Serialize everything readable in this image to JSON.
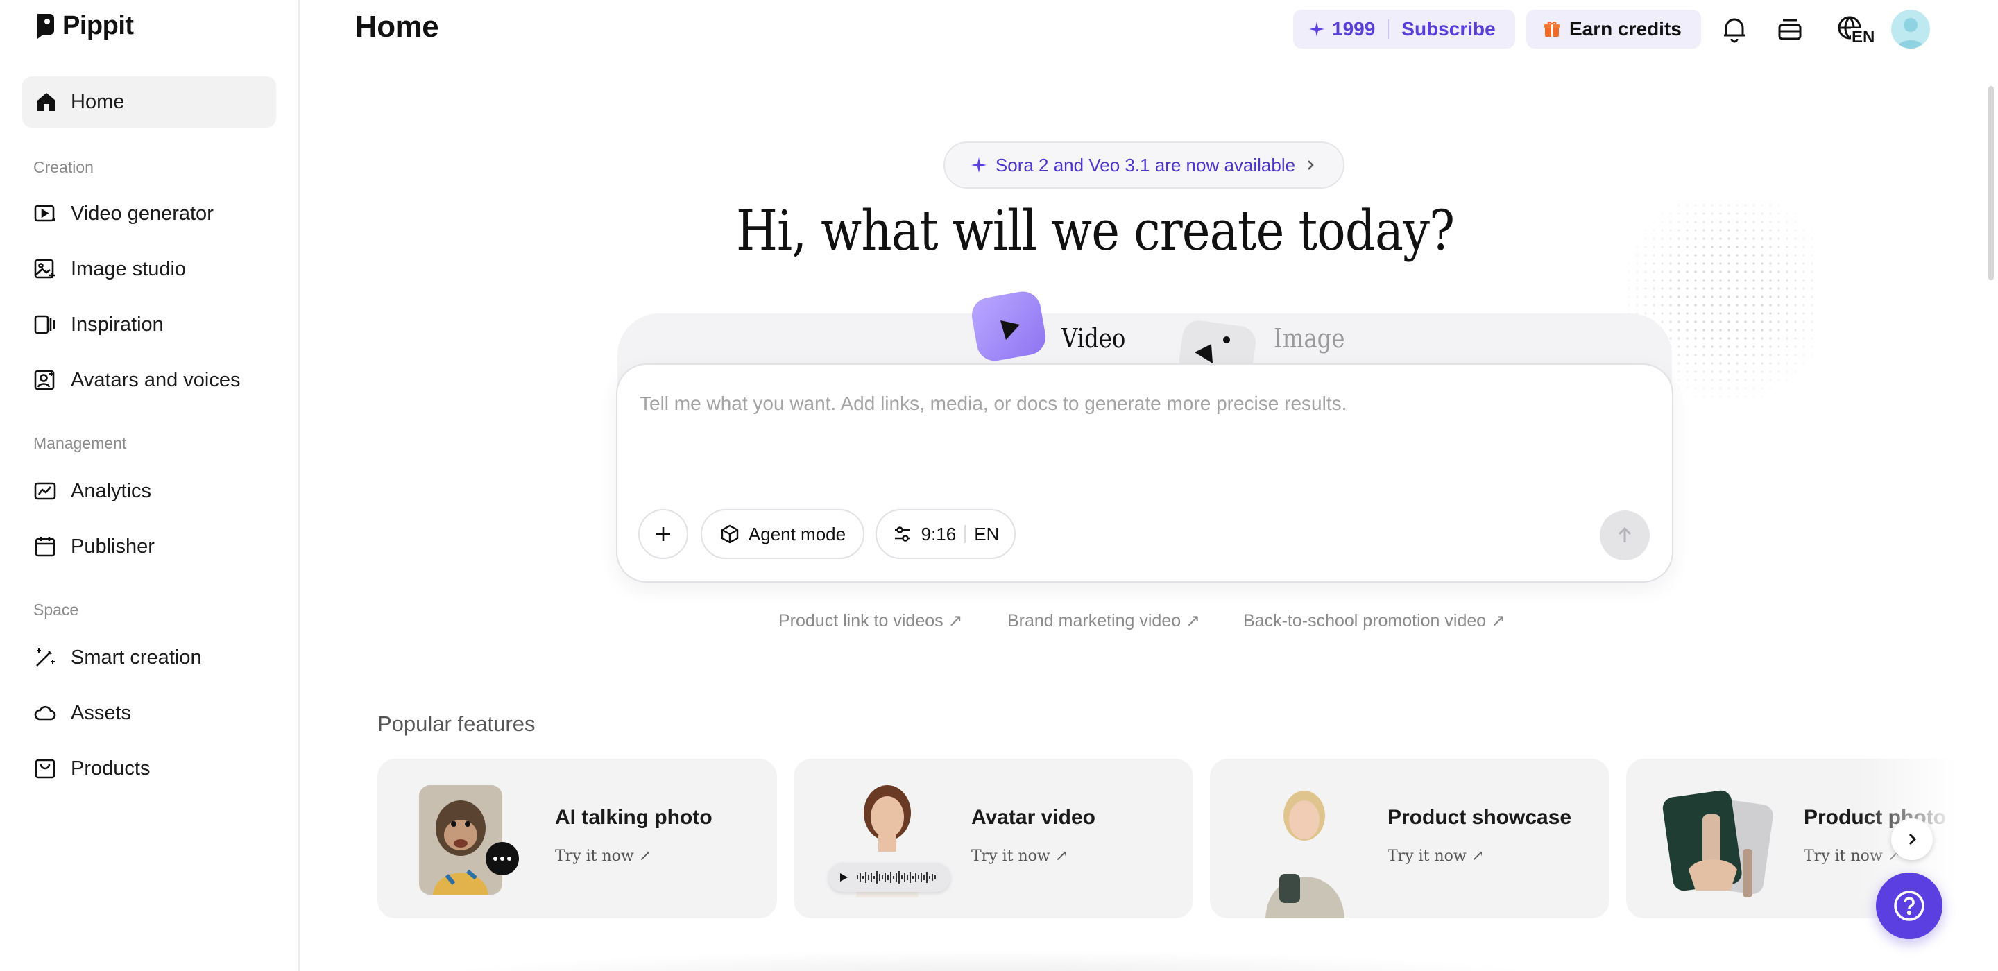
{
  "app": {
    "name": "Pippit"
  },
  "sidebar": {
    "home": {
      "label": "Home",
      "icon": "home-icon"
    },
    "sections": [
      {
        "label": "Creation",
        "items": [
          {
            "label": "Video generator",
            "icon": "video-generator-icon"
          },
          {
            "label": "Image studio",
            "icon": "image-studio-icon"
          },
          {
            "label": "Inspiration",
            "icon": "inspiration-icon"
          },
          {
            "label": "Avatars and voices",
            "icon": "avatar-voice-icon"
          }
        ]
      },
      {
        "label": "Management",
        "items": [
          {
            "label": "Analytics",
            "icon": "analytics-icon"
          },
          {
            "label": "Publisher",
            "icon": "calendar-icon"
          }
        ]
      },
      {
        "label": "Space",
        "items": [
          {
            "label": "Smart creation",
            "icon": "magic-wand-icon"
          },
          {
            "label": "Assets",
            "icon": "cloud-icon"
          },
          {
            "label": "Products",
            "icon": "bag-icon"
          }
        ]
      }
    ]
  },
  "header": {
    "title": "Home",
    "credits": "1999",
    "subscribe_label": "Subscribe",
    "earn_label": "Earn credits",
    "language": "EN",
    "accent_color": "#5b3fe0"
  },
  "hero": {
    "announcement": "Sora 2 and Veo 3.1 are now available",
    "headline": "Hi, what will we create today?",
    "tabs": [
      {
        "label": "Video",
        "selected": true
      },
      {
        "label": "Image",
        "selected": false
      }
    ],
    "prompt_placeholder": "Tell me what you want. Add links, media, or docs to generate more precise results.",
    "agent_mode_label": "Agent mode",
    "aspect_ratio": "9:16",
    "output_language": "EN",
    "suggestions": [
      "Product link to videos ↗",
      "Brand marketing video ↗",
      "Back-to-school promotion video ↗"
    ]
  },
  "popular": {
    "title": "Popular features",
    "cards": [
      {
        "title": "AI talking photo",
        "cta": "Try it now ↗"
      },
      {
        "title": "Avatar video",
        "cta": "Try it now ↗"
      },
      {
        "title": "Product showcase",
        "cta": "Try it now ↗"
      },
      {
        "title": "Product photo",
        "cta": "Try it now ↗"
      }
    ]
  }
}
